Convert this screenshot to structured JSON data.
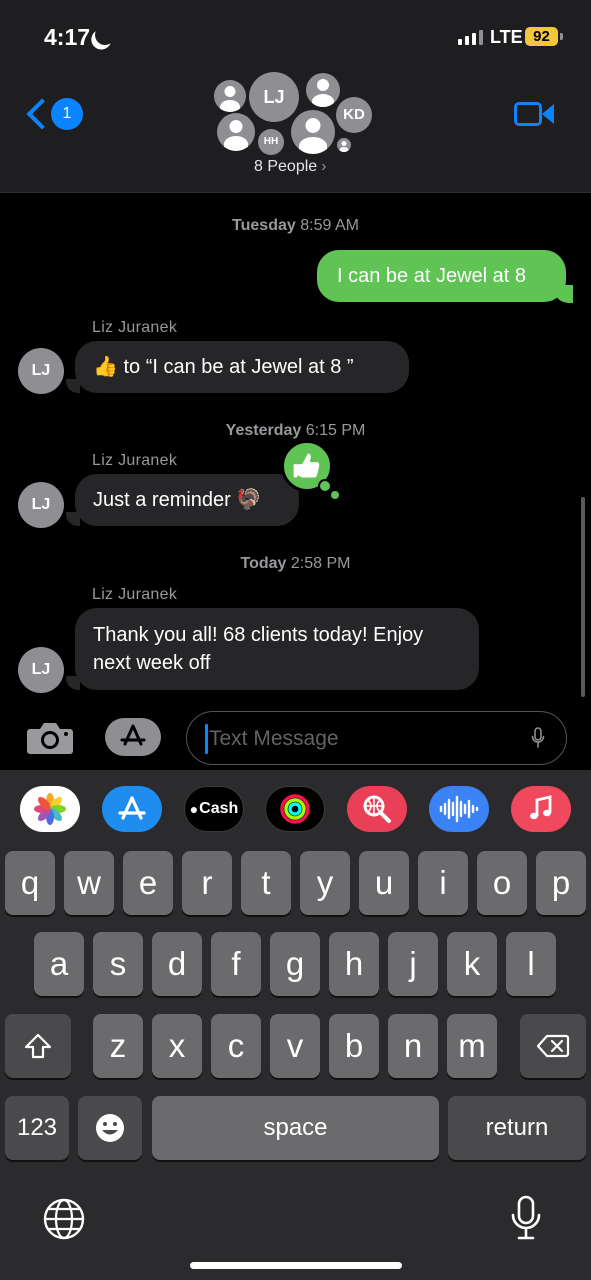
{
  "status_bar": {
    "time": "4:17",
    "network": "LTE",
    "battery": "92",
    "colors": {
      "battery": "#f2c73a"
    }
  },
  "header": {
    "back_badge": "1",
    "participants_label": "8 People",
    "avatars": [
      "LJ",
      "KD",
      "HH"
    ],
    "colors": {
      "accent": "#0a84ff"
    }
  },
  "conversation": {
    "messages": [
      {
        "type": "timestamp",
        "day": "Tuesday",
        "time": "8:59 AM"
      },
      {
        "type": "outgoing",
        "text": "I can be at Jewel at 8"
      },
      {
        "type": "incoming",
        "sender": "Liz Juranek",
        "avatar": "LJ",
        "icon": "thumbs-up-icon",
        "text": "to “I can be at Jewel at 8 ”"
      },
      {
        "type": "timestamp",
        "day": "Yesterday",
        "time": "6:15 PM"
      },
      {
        "type": "incoming",
        "sender": "Liz Juranek",
        "avatar": "LJ",
        "text": "Just a reminder",
        "emoji": "🦃",
        "reaction": "thumbs-up-icon"
      },
      {
        "type": "timestamp",
        "day": "Today",
        "time": "2:58 PM"
      },
      {
        "type": "incoming",
        "sender": "Liz Juranek",
        "avatar": "LJ",
        "text": "Thank you all! 68 clients today! Enjoy next week off"
      }
    ],
    "colors": {
      "outgoing": "#5fc454",
      "incoming": "#262629"
    }
  },
  "compose": {
    "placeholder": "Text Message"
  },
  "app_drawer": [
    {
      "name": "photos-app-icon",
      "label": ""
    },
    {
      "name": "app-store-icon",
      "label": ""
    },
    {
      "name": "apple-cash-icon",
      "label": "Cash"
    },
    {
      "name": "fitness-icon",
      "label": ""
    },
    {
      "name": "image-search-icon",
      "label": ""
    },
    {
      "name": "audio-message-icon",
      "label": ""
    },
    {
      "name": "music-icon",
      "label": ""
    }
  ],
  "keyboard": {
    "row1": [
      "q",
      "w",
      "e",
      "r",
      "t",
      "y",
      "u",
      "i",
      "o",
      "p"
    ],
    "row2": [
      "a",
      "s",
      "d",
      "f",
      "g",
      "h",
      "j",
      "k",
      "l"
    ],
    "row3": [
      "z",
      "x",
      "c",
      "v",
      "b",
      "n",
      "m"
    ],
    "numbers_key": "123",
    "space_key": "space",
    "return_key": "return"
  }
}
